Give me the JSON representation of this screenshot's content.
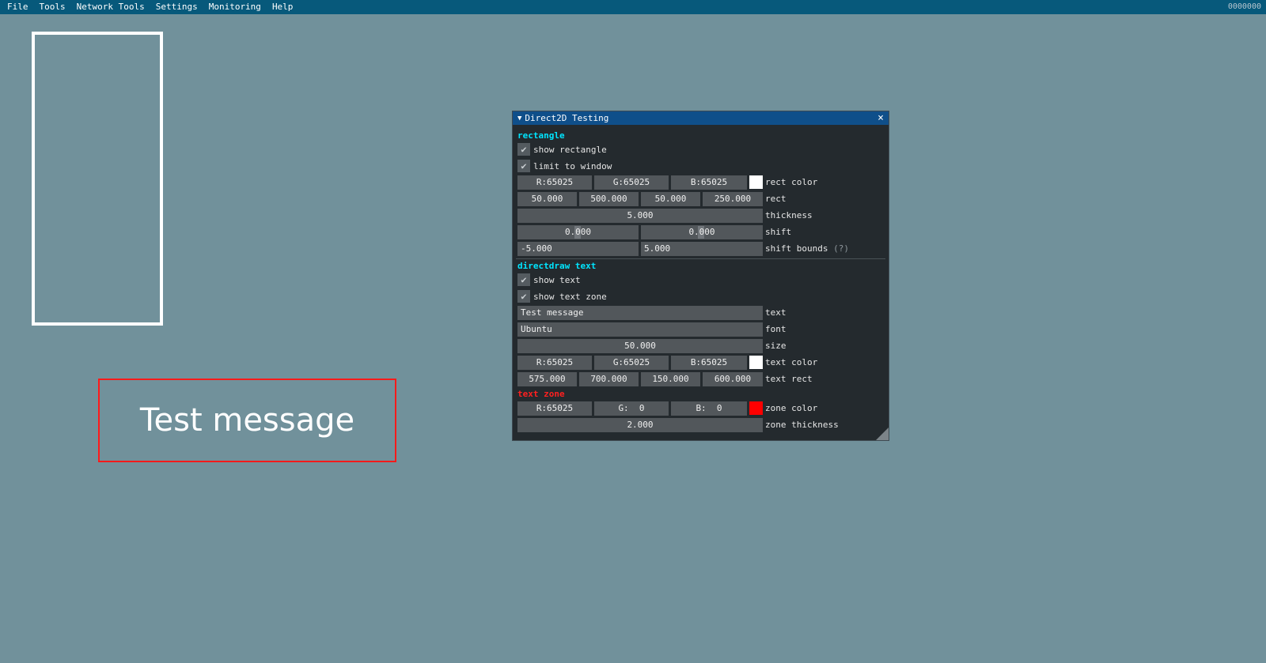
{
  "menubar": {
    "items": [
      "File",
      "Tools",
      "Network Tools",
      "Settings",
      "Monitoring",
      "Help"
    ],
    "right_text": "0000000"
  },
  "canvas": {
    "text_zone_text": "Test message"
  },
  "window": {
    "title": "Direct2D Testing",
    "close_icon": "×",
    "rectangle_section": {
      "header": "rectangle",
      "show_rectangle": {
        "label": "show rectangle",
        "checked": true
      },
      "limit_to_window": {
        "label": "limit to window",
        "checked": true
      },
      "color": {
        "r": "R:65025",
        "g": "G:65025",
        "b": "B:65025",
        "label": "rect color",
        "swatch": "#ffffff"
      },
      "rect": {
        "v1": "50.000",
        "v2": "500.000",
        "v3": "50.000",
        "v4": "250.000",
        "label": "rect"
      },
      "thickness": {
        "value": "5.000",
        "label": "thickness"
      },
      "shift": {
        "x": "0.000",
        "y": "0.000",
        "label": "shift"
      },
      "shift_bounds": {
        "min": "-5.000",
        "max": "5.000",
        "label": "shift bounds",
        "help": "(?)"
      }
    },
    "text_section": {
      "header": "directdraw text",
      "show_text": {
        "label": "show text",
        "checked": true
      },
      "show_text_zone": {
        "label": "show text zone",
        "checked": true
      },
      "text": {
        "value": "Test message",
        "label": "text"
      },
      "font": {
        "value": "Ubuntu",
        "label": "font"
      },
      "size": {
        "value": "50.000",
        "label": "size"
      },
      "color": {
        "r": "R:65025",
        "g": "G:65025",
        "b": "B:65025",
        "label": "text color",
        "swatch": "#ffffff"
      },
      "rect": {
        "v1": "575.000",
        "v2": "700.000",
        "v3": "150.000",
        "v4": "600.000",
        "label": "text rect"
      }
    },
    "zone_section": {
      "header": "text zone",
      "color": {
        "r": "R:65025",
        "g": "G:  0",
        "b": "B:  0",
        "label": "zone color",
        "swatch": "#ff0000"
      },
      "thickness": {
        "value": "2.000",
        "label": "zone thickness"
      }
    }
  }
}
